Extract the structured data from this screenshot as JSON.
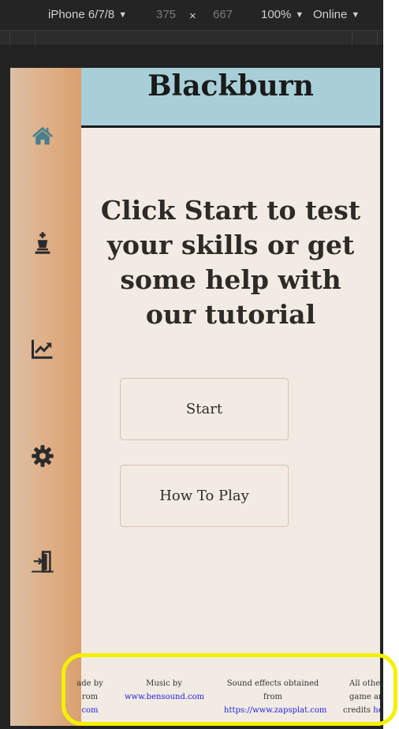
{
  "devtools": {
    "device": "iPhone 6/7/8",
    "width": "375",
    "times": "×",
    "height": "667",
    "zoom": "100%",
    "network": "Online",
    "dropdown_glyph": "▼"
  },
  "app": {
    "title": "Blackburn",
    "headline": "Click Start to test your skills or get some help with our tutorial",
    "start_label": "Start",
    "howto_label": "How To Play"
  },
  "sidebar": {
    "items": [
      {
        "icon": "home-icon"
      },
      {
        "icon": "chess-king-icon"
      },
      {
        "icon": "stats-chart-icon"
      },
      {
        "icon": "settings-gear-icon"
      },
      {
        "icon": "exit-door-icon"
      }
    ]
  },
  "footer": {
    "credit1": {
      "line1": "ade by",
      "line2": "rom",
      "line3": "com"
    },
    "credit2": {
      "line1": "Music by",
      "link": "www.bensound.com"
    },
    "credit3": {
      "line1": "Sound effects obtained",
      "line2": "from",
      "link": "https://www.zapsplat.com"
    },
    "credit4": {
      "line1": "All other",
      "line2": "game art",
      "line3": "credits",
      "link": "he"
    }
  },
  "colors": {
    "header_bg": "#a8cfd8",
    "content_bg": "#f2ebe4",
    "sidebar_start": "#dcc0a6",
    "sidebar_end": "#d9a06e",
    "home_icon": "#4a7f8c",
    "icon": "#2b2b2b",
    "highlight": "#f4f000",
    "link": "#2222dd"
  }
}
